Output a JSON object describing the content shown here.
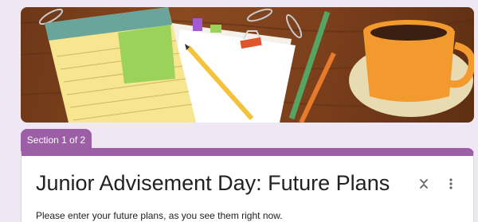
{
  "header": {
    "banner_image": "desk-notepad-pencil-coffee-illustration"
  },
  "section": {
    "indicator": "Section 1 of 2"
  },
  "form": {
    "title": "Junior Advisement Day: Future Plans",
    "description": "Please enter your future plans, as you see them right now."
  },
  "icons": {
    "collapse": "collapse-section-icon",
    "more": "more-vert-icon"
  },
  "colors": {
    "background": "#f0e7f4",
    "accent": "#9c5fa6",
    "card": "#ffffff",
    "text": "#202124"
  }
}
